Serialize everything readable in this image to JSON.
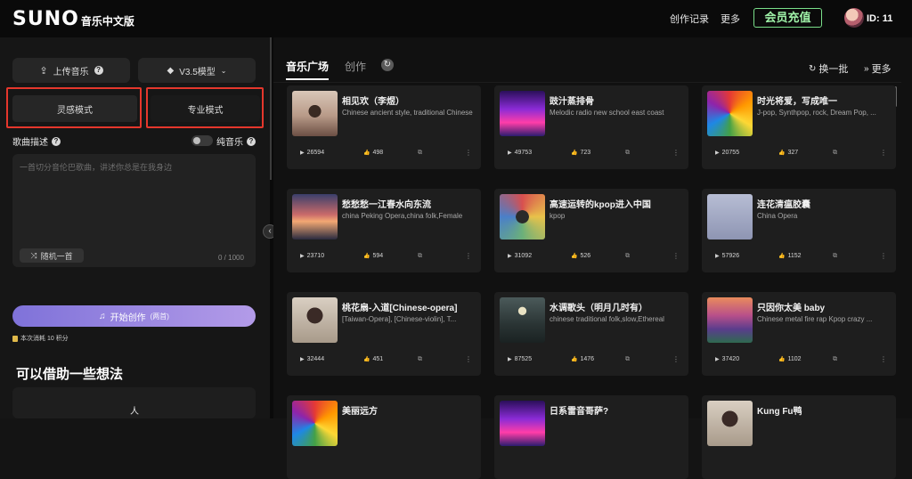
{
  "header": {
    "logo_main": "SUNO",
    "logo_sub": "音乐中文版",
    "nav_records": "创作记录",
    "nav_more": "更多",
    "vip_label": "会员充值",
    "user_id": "ID: 11"
  },
  "sidebar": {
    "upload_label": "上传音乐",
    "model_label": "V3.5模型",
    "inspiration_mode": "灵感模式",
    "pro_mode": "专业模式",
    "desc_label": "歌曲描述",
    "pure_music_label": "纯音乐",
    "desc_placeholder": "一首切分音伦巴歌曲，讲述你总是在我身边",
    "random_label": "随机一首",
    "char_count": "0 / 1000",
    "create_label": "开始创作",
    "create_sub": "(两首)",
    "cost_text": "本次消耗 10 积分",
    "ideas_title": "可以借助一些想法",
    "ideas_item": "人"
  },
  "main": {
    "tab_square": "音乐广场",
    "tab_create": "创作",
    "batch_label": "换一批",
    "more_label": "更多",
    "cards": [
      {
        "title": "相见欢（李煜）",
        "tags": "Chinese ancient style, traditional Chinese",
        "plays": "26594",
        "likes": "498",
        "thumb": "tree"
      },
      {
        "title": "豉汁蒸排骨",
        "tags": "Melodic radio new school east coast",
        "plays": "49753",
        "likes": "723",
        "thumb": "city"
      },
      {
        "title": "时光将爱，写成唯一",
        "tags": "J-pop, Synthpop, rock, Dream Pop, ...",
        "plays": "20755",
        "likes": "327",
        "thumb": "swirl"
      },
      {
        "title": "愁愁愁一江春水向东流",
        "tags": "china Peking Opera,china folk,Female",
        "plays": "23710",
        "likes": "594",
        "thumb": "sunset"
      },
      {
        "title": "高速运转的kpop进入中国",
        "tags": "kpop",
        "plays": "31092",
        "likes": "526",
        "thumb": "flowers"
      },
      {
        "title": "连花清瘟胶囊",
        "tags": "China Opera",
        "plays": "57926",
        "likes": "1152",
        "thumb": "box"
      },
      {
        "title": "桃花扇-入道[Chinese-opera]",
        "tags": "[Taiwan-Opera], [Chinese-violin], T...",
        "plays": "32444",
        "likes": "451",
        "thumb": "opera"
      },
      {
        "title": "水调歌头（明月几时有）",
        "tags": "chinese traditional folk,slow,Ethereal",
        "plays": "87525",
        "likes": "1476",
        "thumb": "moon"
      },
      {
        "title": "只因你太美 baby",
        "tags": "Chinese metal fire rap Kpop crazy ...",
        "plays": "37420",
        "likes": "1102",
        "thumb": "valley"
      },
      {
        "title": "美丽远方",
        "tags": "",
        "plays": "",
        "likes": "",
        "thumb": "swirl"
      },
      {
        "title": "日系雷音哥萨?",
        "tags": "",
        "plays": "",
        "likes": "",
        "thumb": "city"
      },
      {
        "title": "Kung Fu鸭",
        "tags": "",
        "plays": "",
        "likes": "",
        "thumb": "opera"
      }
    ]
  },
  "colors": {
    "accent_red": "#e5372c",
    "vip_green": "#7adf8a",
    "create_gradient_start": "#7f72d9",
    "create_gradient_end": "#b39be8"
  },
  "icons": {
    "upload": "upload-icon",
    "model": "cube-icon",
    "help": "question-icon",
    "shuffle": "shuffle-icon",
    "music": "music-note-icon",
    "refresh": "refresh-icon",
    "play": "play-icon",
    "like": "thumbs-up-icon",
    "share": "share-icon",
    "more": "more-vertical-icon"
  }
}
